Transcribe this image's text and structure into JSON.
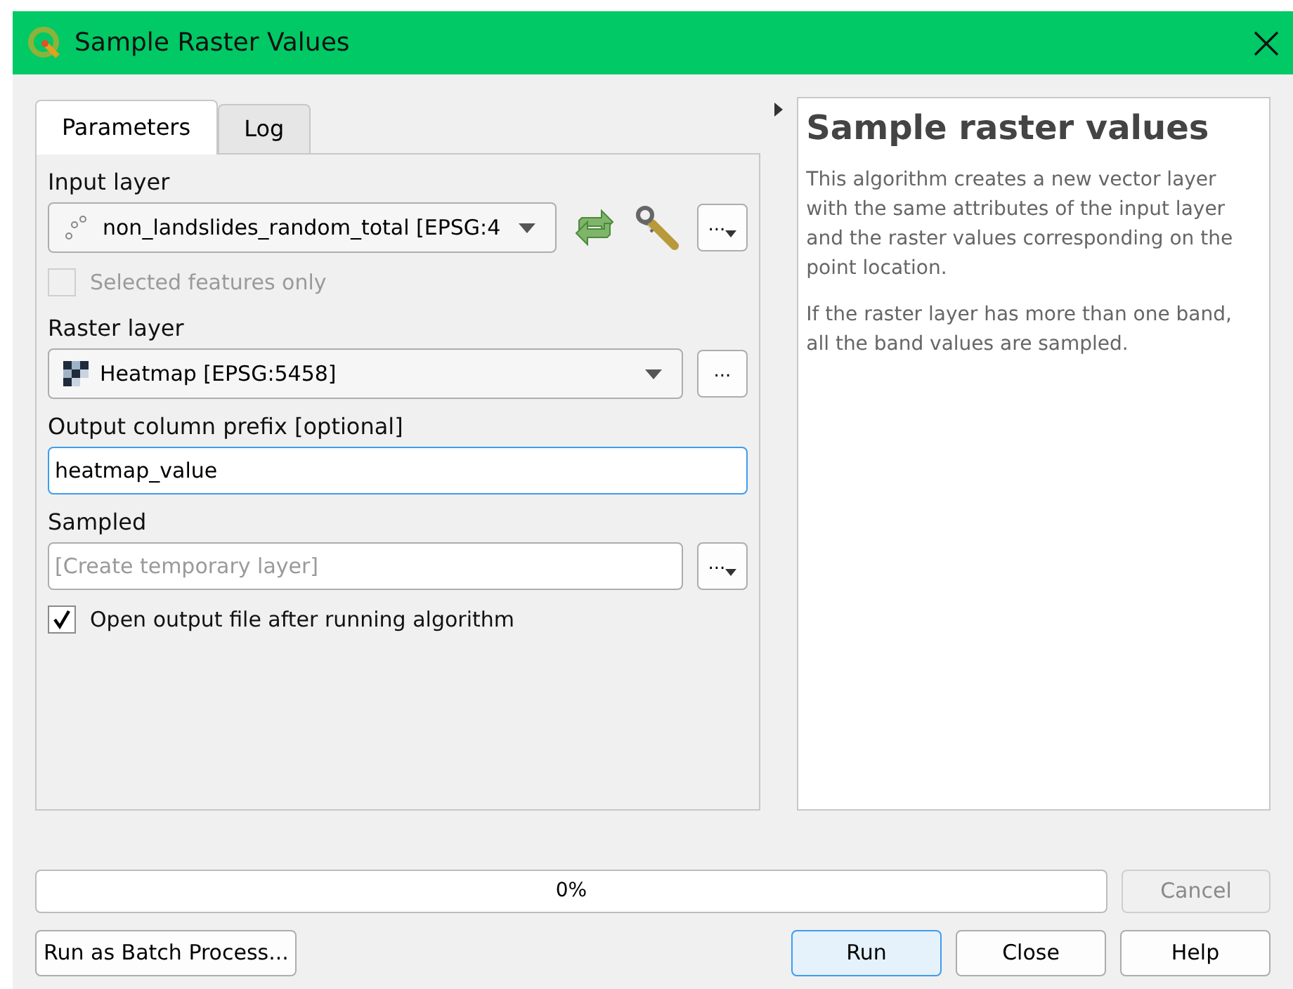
{
  "window": {
    "title": "Sample Raster Values"
  },
  "tabs": [
    {
      "label": "Parameters",
      "selected": true
    },
    {
      "label": "Log",
      "selected": false
    }
  ],
  "input_layer": {
    "label": "Input layer",
    "value": "non_landslides_random_total [EPSG:4"
  },
  "selected_features_only": {
    "label": "Selected features only",
    "checked": false,
    "disabled": true
  },
  "raster_layer": {
    "label": "Raster layer",
    "value": "Heatmap [EPSG:5458]"
  },
  "output_column_prefix": {
    "label": "Output column prefix [optional]",
    "value": "heatmap_value"
  },
  "sampled": {
    "label": "Sampled",
    "placeholder": "[Create temporary layer]"
  },
  "open_output": {
    "label": "Open output file after running algorithm",
    "checked": true
  },
  "ellipsis": "...",
  "help": {
    "title": "Sample raster values",
    "paragraphs": [
      "This algorithm creates a new vector layer with the same attributes of the input layer and the raster values corresponding on the point location.",
      "If the raster layer has more than one band, all the band values are sampled."
    ]
  },
  "progress": {
    "level": 0,
    "reading": "0%"
  },
  "cancel": {
    "label": "Cancel",
    "disabled": true
  },
  "batch_button": {
    "label": "Run as Batch Process..."
  },
  "buttons": [
    {
      "label": "Run",
      "default": true
    },
    {
      "label": "Close",
      "default": false
    },
    {
      "label": "Help",
      "default": false
    }
  ]
}
